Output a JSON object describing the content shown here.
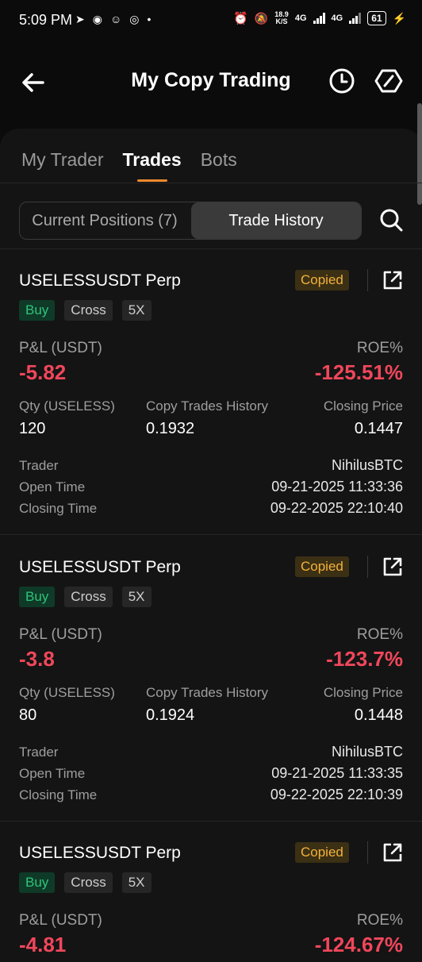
{
  "status_bar": {
    "time": "5:09 PM",
    "speed_top": "18.9",
    "speed_unit": "K/S",
    "net1": "4G",
    "net2": "4G",
    "battery": "61"
  },
  "header": {
    "title": "My Copy Trading"
  },
  "tabs": [
    {
      "label": "My Trader"
    },
    {
      "label": "Trades"
    },
    {
      "label": "Bots"
    }
  ],
  "segments": [
    {
      "label": "Current Positions (7)"
    },
    {
      "label": "Trade History"
    }
  ],
  "labels": {
    "copied": "Copied",
    "buy": "Buy",
    "cross": "Cross",
    "leverage": "5X",
    "pnl": "P&L (USDT)",
    "roe": "ROE%",
    "qty": "Qty (USELESS)",
    "copy_trades": "Copy Trades History",
    "closing_price": "Closing Price",
    "trader": "Trader",
    "open_time": "Open Time",
    "closing_time": "Closing Time"
  },
  "trades": [
    {
      "symbol": "USELESSUSDT Perp",
      "pnl": "-5.82",
      "roe": "-125.51%",
      "qty": "120",
      "copy_trades": "0.1932",
      "closing_price": "0.1447",
      "trader": "NihilusBTC",
      "open_time": "09-21-2025 11:33:36",
      "closing_time": "09-22-2025 22:10:40"
    },
    {
      "symbol": "USELESSUSDT Perp",
      "pnl": "-3.8",
      "roe": "-123.7%",
      "qty": "80",
      "copy_trades": "0.1924",
      "closing_price": "0.1448",
      "trader": "NihilusBTC",
      "open_time": "09-21-2025 11:33:35",
      "closing_time": "09-22-2025 22:10:39"
    },
    {
      "symbol": "USELESSUSDT Perp",
      "pnl": "-4.81",
      "roe": "-124.67%"
    }
  ]
}
